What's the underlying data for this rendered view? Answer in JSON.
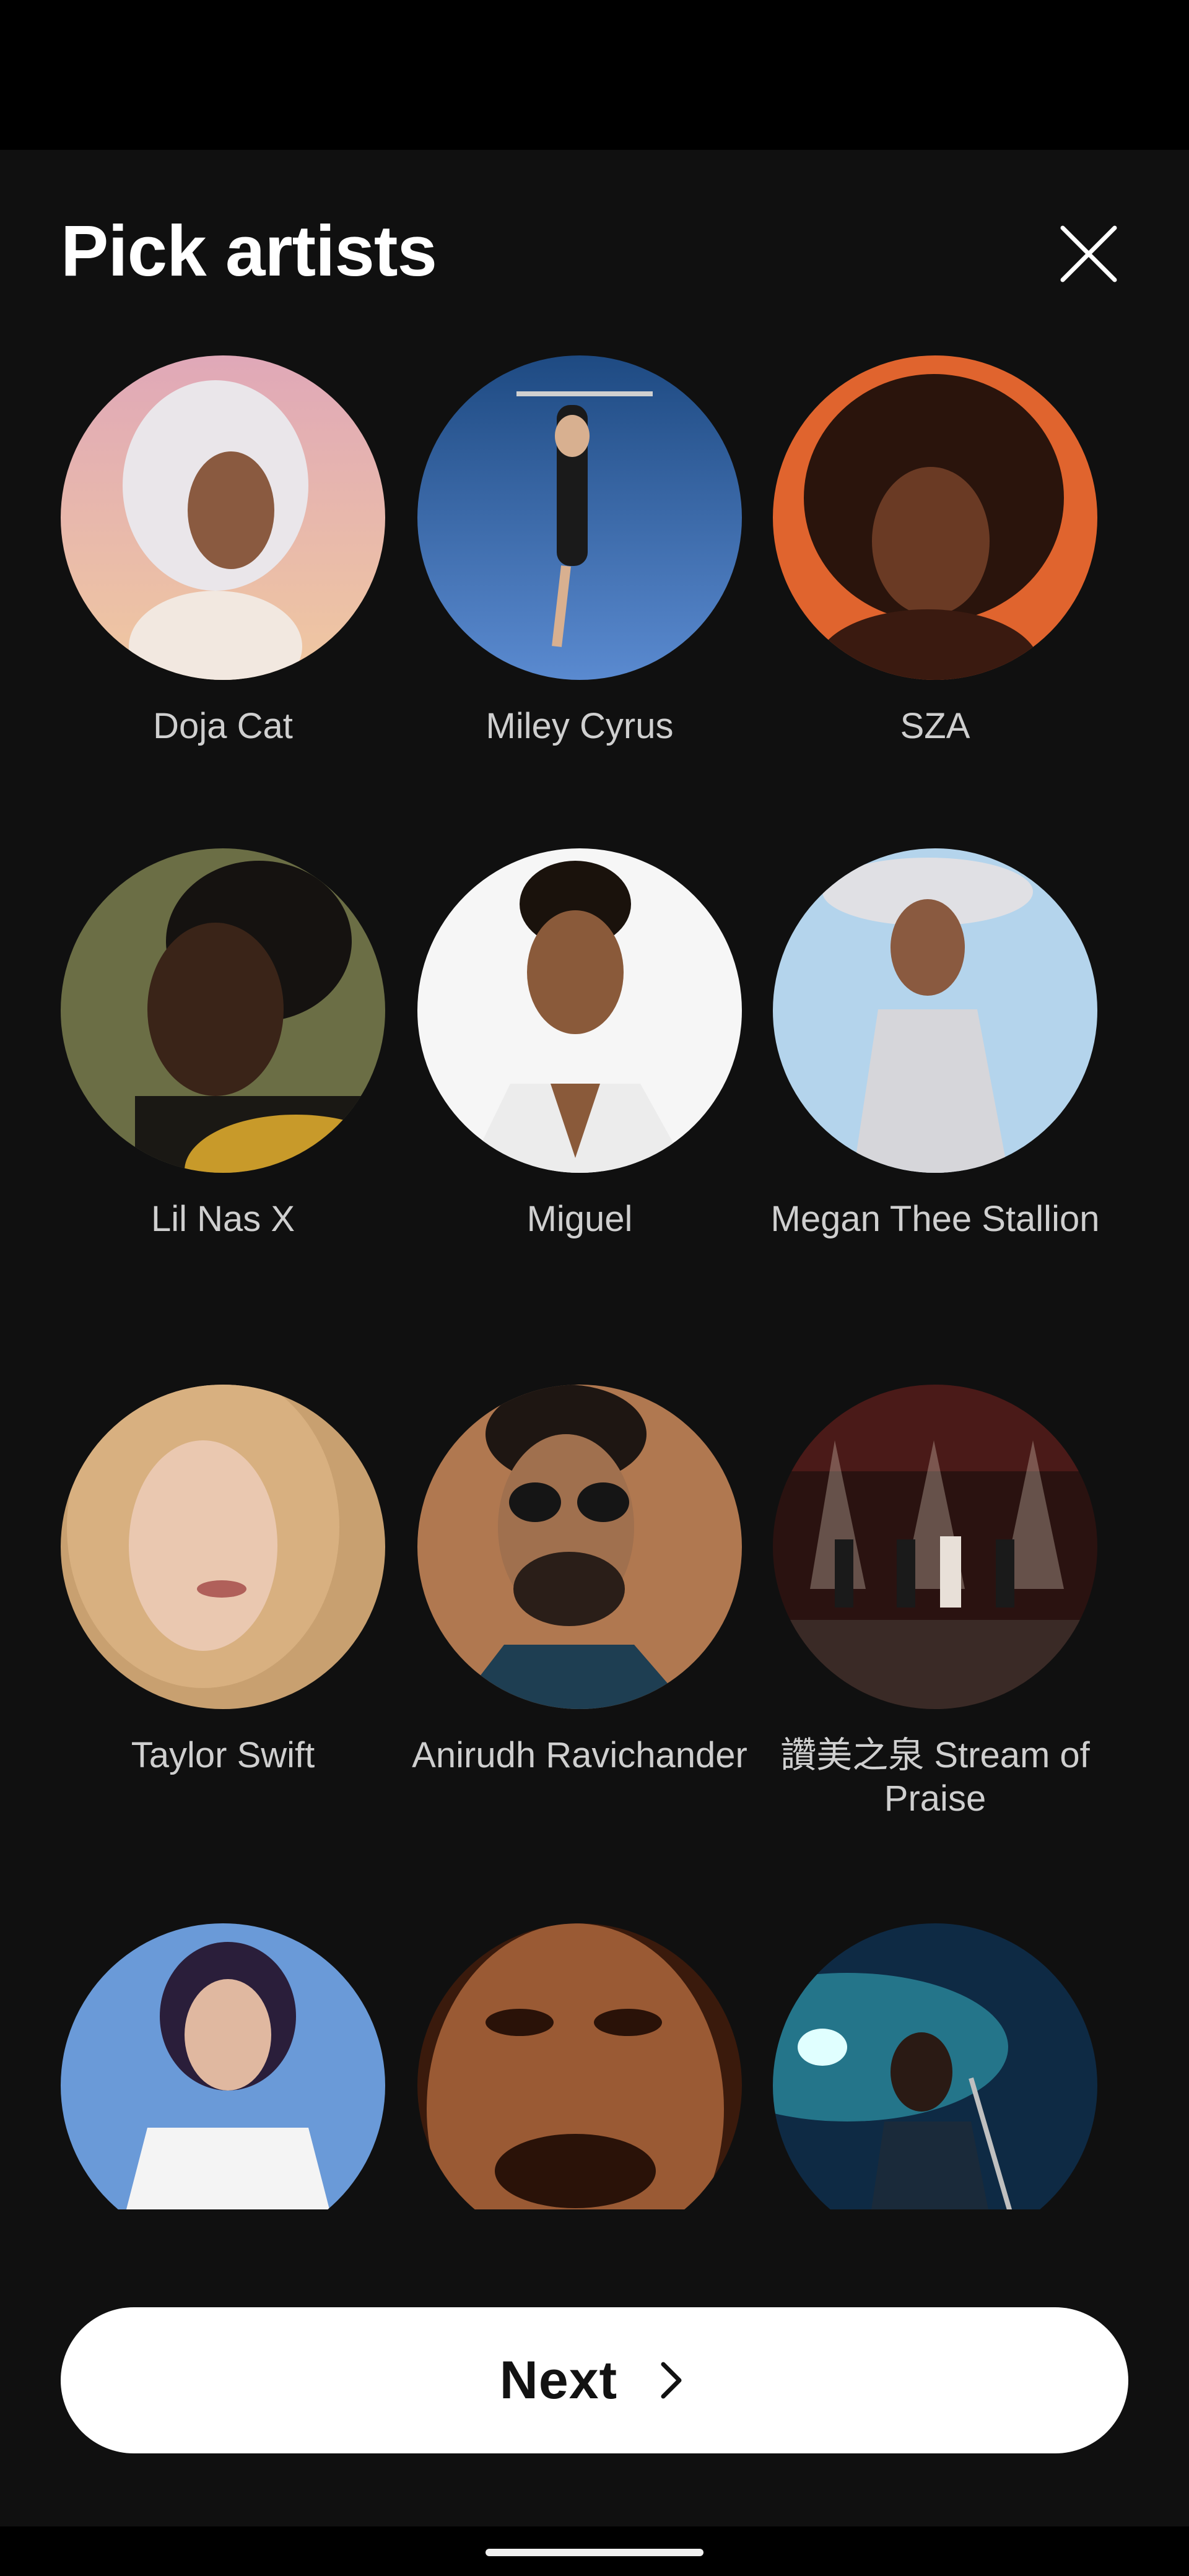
{
  "header": {
    "title": "Pick artists",
    "close_icon": "close-icon"
  },
  "artists": [
    {
      "name": "Doja Cat",
      "bg": "#e8b8a8",
      "fg": "#f5f0f0"
    },
    {
      "name": "Miley Cyrus",
      "bg": "#2f5f9a",
      "fg": "#1a1a1a"
    },
    {
      "name": "SZA",
      "bg": "#d8502a",
      "fg": "#2a140c"
    },
    {
      "name": "Lil Nas X",
      "bg": "#6b6e45",
      "fg": "#1a120c"
    },
    {
      "name": "Miguel",
      "bg": "#f4f4f4",
      "fg": "#2a1c14"
    },
    {
      "name": "Megan Thee Stallion",
      "bg": "#a9cde8",
      "fg": "#d8d8dc"
    },
    {
      "name": "Taylor Swift",
      "bg": "#c89a5c",
      "fg": "#e8c8a8"
    },
    {
      "name": "Anirudh Ravichander",
      "bg": "#b07850",
      "fg": "#2a1e18"
    },
    {
      "name": "讚美之泉 Stream of Praise",
      "bg": "#3a1a18",
      "fg": "#d8c8b8"
    },
    {
      "name": "",
      "bg": "#5a8ad0",
      "fg": "#f0f0f0"
    },
    {
      "name": "",
      "bg": "#6a3a20",
      "fg": "#2a1208"
    },
    {
      "name": "",
      "bg": "#1a4a6a",
      "fg": "#40d0e0"
    }
  ],
  "next_button": {
    "label": "Next",
    "icon": "chevron-right-icon"
  },
  "colors": {
    "background": "#101010",
    "button_bg": "#ffffff",
    "artist_name": "#cfcfcf"
  }
}
